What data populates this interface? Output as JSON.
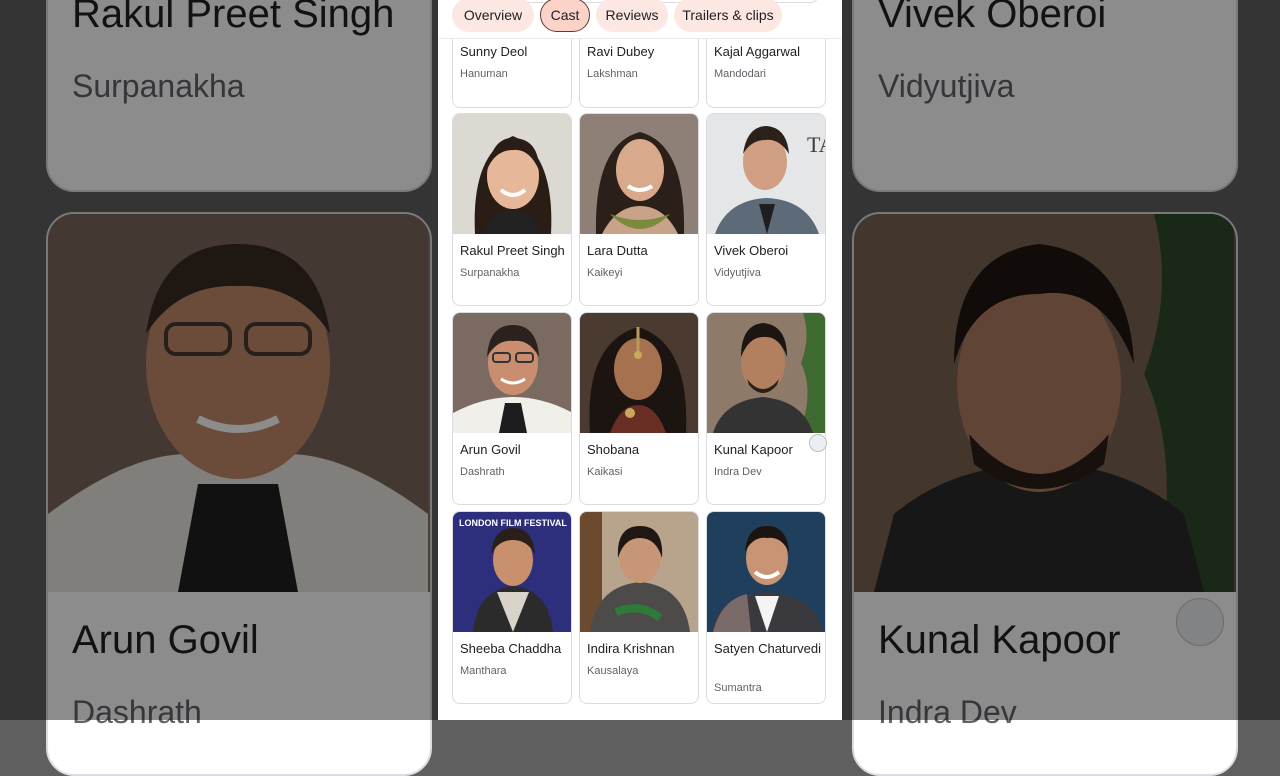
{
  "tabs": [
    {
      "label": "Overview"
    },
    {
      "label": "Cast",
      "active": true
    },
    {
      "label": "Reviews"
    },
    {
      "label": "Trailers & clips"
    }
  ],
  "cast": [
    {
      "name": "Sunny Deol",
      "role": "Hanuman"
    },
    {
      "name": "Ravi Dubey",
      "role": "Lakshman"
    },
    {
      "name": "Kajal Aggarwal",
      "role": "Mandodari"
    },
    {
      "name": "Rakul Preet Singh",
      "role": "Surpanakha"
    },
    {
      "name": "Lara Dutta",
      "role": "Kaikeyi"
    },
    {
      "name": "Vivek Oberoi",
      "role": "Vidyutjiva"
    },
    {
      "name": "Arun Govil",
      "role": "Dashrath"
    },
    {
      "name": "Shobana",
      "role": "Kaikasi"
    },
    {
      "name": "Kunal Kapoor",
      "role": "Indra Dev"
    },
    {
      "name": "Sheeba Chaddha",
      "role": "Manthara"
    },
    {
      "name": "Indira Krishnan",
      "role": "Kausalaya"
    },
    {
      "name": "Satyen Chaturvedi",
      "role": "Sumantra"
    }
  ],
  "poster_text": "LONDON FILM FESTIVAL",
  "colors": {
    "tab_bg": "#fde7e2",
    "tab_active_bg": "#fbd3c9",
    "card_border": "#dadce0",
    "text_primary": "#202124",
    "text_secondary": "#5f6368"
  }
}
